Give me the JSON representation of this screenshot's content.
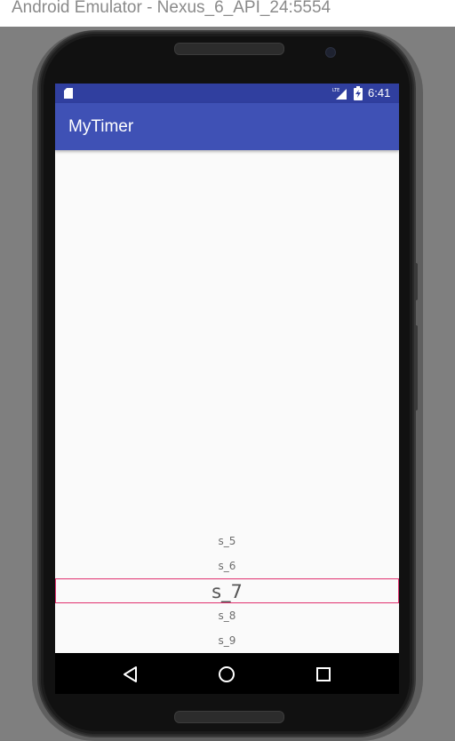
{
  "window": {
    "title": "Android Emulator - Nexus_6_API_24:5554"
  },
  "status_bar": {
    "time": "6:41",
    "icons": [
      "sd-card-icon",
      "lte-signal-icon",
      "battery-charging-icon"
    ],
    "color": "#303f9f"
  },
  "app_bar": {
    "title": "MyTimer",
    "color": "#3f51b5"
  },
  "picker": {
    "items": [
      "s_5",
      "s_6",
      "s_7",
      "s_8",
      "s_9"
    ],
    "selected": "s_7",
    "selection_border_color": "#e0306f"
  },
  "nav_bar": {
    "buttons": [
      "back-icon",
      "home-icon",
      "recents-icon"
    ]
  }
}
